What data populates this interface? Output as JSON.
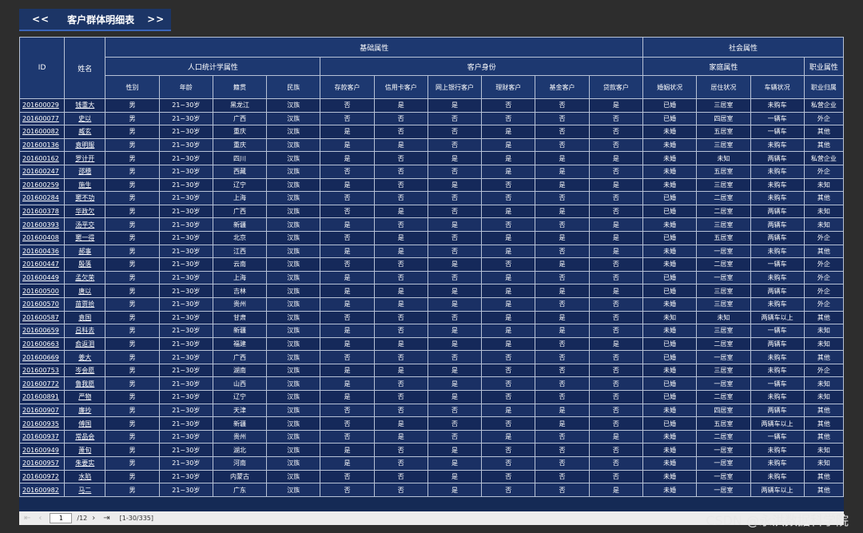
{
  "header": {
    "prev": "<<",
    "title": "客户群体明细表",
    "next": ">>"
  },
  "table": {
    "top_headers": {
      "id": "ID",
      "name": "姓名",
      "basic": "基础属性",
      "social": "社会属性"
    },
    "mid_headers": {
      "demographic": "人口统计学属性",
      "customer_identity": "客户身份",
      "family": "家庭属性",
      "occupation": "职业属性"
    },
    "columns": [
      "性别",
      "年龄",
      "籍贯",
      "民族",
      "存款客户",
      "信用卡客户",
      "网上银行客户",
      "理财客户",
      "基金客户",
      "贷款客户",
      "婚姻状况",
      "居住状况",
      "车辆状况",
      "职业归属"
    ],
    "rows": [
      [
        "201600029",
        "钱重大",
        "男",
        "21~30岁",
        "黑龙江",
        "汉族",
        "否",
        "是",
        "是",
        "否",
        "否",
        "是",
        "已婚",
        "三居室",
        "未购车",
        "私营企业"
      ],
      [
        "201600077",
        "史以",
        "男",
        "21~30岁",
        "广西",
        "汉族",
        "否",
        "否",
        "否",
        "否",
        "否",
        "否",
        "已婚",
        "四居室",
        "一辆车",
        "外企"
      ],
      [
        "201600082",
        "臧玄",
        "男",
        "21~30岁",
        "重庆",
        "汉族",
        "是",
        "否",
        "否",
        "是",
        "否",
        "否",
        "未婚",
        "五居室",
        "一辆车",
        "其他"
      ],
      [
        "201600136",
        "袁明服",
        "男",
        "21~30岁",
        "重庆",
        "汉族",
        "是",
        "是",
        "否",
        "是",
        "否",
        "否",
        "未婚",
        "三居室",
        "未购车",
        "其他"
      ],
      [
        "201600162",
        "罗计开",
        "男",
        "21~30岁",
        "四川",
        "汉族",
        "是",
        "否",
        "是",
        "是",
        "是",
        "是",
        "未婚",
        "未知",
        "两辆车",
        "私营企业"
      ],
      [
        "201600247",
        "邵穗",
        "男",
        "21~30岁",
        "西藏",
        "汉族",
        "否",
        "否",
        "否",
        "是",
        "是",
        "否",
        "未婚",
        "五居室",
        "未购车",
        "外企"
      ],
      [
        "201600259",
        "施生",
        "男",
        "21~30岁",
        "辽宁",
        "汉族",
        "是",
        "否",
        "是",
        "否",
        "是",
        "是",
        "未婚",
        "三居室",
        "未购车",
        "未知"
      ],
      [
        "201600284",
        "窦不功",
        "男",
        "21~30岁",
        "上海",
        "汉族",
        "否",
        "否",
        "否",
        "否",
        "否",
        "否",
        "已婚",
        "二居室",
        "未购车",
        "其他"
      ],
      [
        "201600378",
        "华政欠",
        "男",
        "21~30岁",
        "广西",
        "汉族",
        "否",
        "是",
        "否",
        "是",
        "是",
        "否",
        "已婚",
        "二居室",
        "两辆车",
        "未知"
      ],
      [
        "201600393",
        "汤平交",
        "男",
        "21~30岁",
        "新疆",
        "汉族",
        "是",
        "否",
        "是",
        "否",
        "否",
        "是",
        "未婚",
        "三居室",
        "两辆车",
        "未知"
      ],
      [
        "201600408",
        "窦一得",
        "男",
        "21~30岁",
        "北京",
        "汉族",
        "否",
        "是",
        "否",
        "是",
        "是",
        "是",
        "已婚",
        "五居室",
        "两辆车",
        "外企"
      ],
      [
        "201600436",
        "郝事",
        "男",
        "21~30岁",
        "江西",
        "汉族",
        "是",
        "是",
        "否",
        "是",
        "否",
        "是",
        "未婚",
        "一居室",
        "未购车",
        "其他"
      ],
      [
        "201600447",
        "殷落",
        "男",
        "21~30岁",
        "云南",
        "汉族",
        "否",
        "否",
        "是",
        "否",
        "是",
        "否",
        "未婚",
        "二居室",
        "一辆车",
        "外企"
      ],
      [
        "201600449",
        "孟欠荣",
        "男",
        "21~30岁",
        "上海",
        "汉族",
        "是",
        "否",
        "否",
        "是",
        "否",
        "否",
        "已婚",
        "一居室",
        "未购车",
        "外企"
      ],
      [
        "201600500",
        "唐以",
        "男",
        "21~30岁",
        "吉林",
        "汉族",
        "是",
        "是",
        "是",
        "是",
        "是",
        "是",
        "已婚",
        "三居室",
        "两辆车",
        "外企"
      ],
      [
        "201600570",
        "苗贾拾",
        "男",
        "21~30岁",
        "贵州",
        "汉族",
        "是",
        "是",
        "是",
        "是",
        "否",
        "否",
        "未婚",
        "三居室",
        "未购车",
        "外企"
      ],
      [
        "201600587",
        "袁国",
        "男",
        "21~30岁",
        "甘肃",
        "汉族",
        "否",
        "否",
        "否",
        "是",
        "是",
        "否",
        "未知",
        "未知",
        "两辆车以上",
        "其他"
      ],
      [
        "201600659",
        "吕科去",
        "男",
        "21~30岁",
        "新疆",
        "汉族",
        "是",
        "否",
        "是",
        "是",
        "是",
        "否",
        "未婚",
        "三居室",
        "一辆车",
        "未知"
      ],
      [
        "201600663",
        "俞返泪",
        "男",
        "21~30岁",
        "福建",
        "汉族",
        "是",
        "是",
        "是",
        "是",
        "否",
        "是",
        "已婚",
        "二居室",
        "两辆车",
        "未知"
      ],
      [
        "201600669",
        "姜大",
        "男",
        "21~30岁",
        "广西",
        "汉族",
        "否",
        "否",
        "否",
        "否",
        "否",
        "否",
        "已婚",
        "一居室",
        "未购车",
        "其他"
      ],
      [
        "201600753",
        "岑会愿",
        "男",
        "21~30岁",
        "湖南",
        "汉族",
        "是",
        "是",
        "是",
        "否",
        "否",
        "否",
        "未婚",
        "三居室",
        "未购车",
        "外企"
      ],
      [
        "201600772",
        "鲁我愿",
        "男",
        "21~30岁",
        "山西",
        "汉族",
        "是",
        "否",
        "是",
        "否",
        "否",
        "否",
        "已婚",
        "一居室",
        "一辆车",
        "未知"
      ],
      [
        "201600891",
        "严物",
        "男",
        "21~30岁",
        "辽宁",
        "汉族",
        "是",
        "否",
        "是",
        "否",
        "否",
        "否",
        "已婚",
        "二居室",
        "未购车",
        "未知"
      ],
      [
        "201600907",
        "廉抄",
        "男",
        "21~30岁",
        "天津",
        "汉族",
        "否",
        "否",
        "否",
        "是",
        "是",
        "否",
        "未婚",
        "四居室",
        "两辆车",
        "其他"
      ],
      [
        "201600935",
        "傅国",
        "男",
        "21~30岁",
        "新疆",
        "汉族",
        "否",
        "是",
        "否",
        "否",
        "是",
        "否",
        "已婚",
        "五居室",
        "两辆车以上",
        "其他"
      ],
      [
        "201600937",
        "常品会",
        "男",
        "21~30岁",
        "贵州",
        "汉族",
        "否",
        "是",
        "否",
        "是",
        "否",
        "是",
        "未婚",
        "二居室",
        "一辆车",
        "其他"
      ],
      [
        "201600949",
        "萧旬",
        "男",
        "21~30岁",
        "湖北",
        "汉族",
        "是",
        "否",
        "是",
        "否",
        "否",
        "否",
        "未婚",
        "一居室",
        "未购车",
        "未知"
      ],
      [
        "201600957",
        "朱要实",
        "男",
        "21~30岁",
        "河南",
        "汉族",
        "是",
        "否",
        "是",
        "否",
        "否",
        "否",
        "未婚",
        "一居室",
        "未购车",
        "未知"
      ],
      [
        "201600972",
        "水陷",
        "男",
        "21~30岁",
        "内蒙古",
        "汉族",
        "否",
        "否",
        "是",
        "否",
        "否",
        "否",
        "未婚",
        "一居室",
        "未购车",
        "其他"
      ],
      [
        "201600982",
        "马二",
        "男",
        "21~30岁",
        "广东",
        "汉族",
        "否",
        "否",
        "是",
        "否",
        "否",
        "是",
        "未婚",
        "一居室",
        "两辆车以上",
        "其他"
      ]
    ]
  },
  "pagination": {
    "current_page": "1",
    "total": "/12",
    "range": "[1-30/335]"
  },
  "watermark": "CSDN @永洪数据科学院"
}
